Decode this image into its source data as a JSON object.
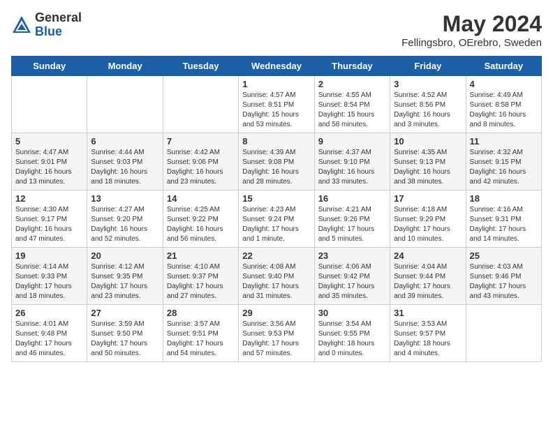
{
  "header": {
    "logo_general": "General",
    "logo_blue": "Blue",
    "month": "May 2024",
    "location": "Fellingsbro, OErebro, Sweden"
  },
  "days_of_week": [
    "Sunday",
    "Monday",
    "Tuesday",
    "Wednesday",
    "Thursday",
    "Friday",
    "Saturday"
  ],
  "weeks": [
    [
      {
        "day": "",
        "info": ""
      },
      {
        "day": "",
        "info": ""
      },
      {
        "day": "",
        "info": ""
      },
      {
        "day": "1",
        "info": "Sunrise: 4:57 AM\nSunset: 8:51 PM\nDaylight: 15 hours\nand 53 minutes."
      },
      {
        "day": "2",
        "info": "Sunrise: 4:55 AM\nSunset: 8:54 PM\nDaylight: 15 hours\nand 58 minutes."
      },
      {
        "day": "3",
        "info": "Sunrise: 4:52 AM\nSunset: 8:56 PM\nDaylight: 16 hours\nand 3 minutes."
      },
      {
        "day": "4",
        "info": "Sunrise: 4:49 AM\nSunset: 8:58 PM\nDaylight: 16 hours\nand 8 minutes."
      }
    ],
    [
      {
        "day": "5",
        "info": "Sunrise: 4:47 AM\nSunset: 9:01 PM\nDaylight: 16 hours\nand 13 minutes."
      },
      {
        "day": "6",
        "info": "Sunrise: 4:44 AM\nSunset: 9:03 PM\nDaylight: 16 hours\nand 18 minutes."
      },
      {
        "day": "7",
        "info": "Sunrise: 4:42 AM\nSunset: 9:06 PM\nDaylight: 16 hours\nand 23 minutes."
      },
      {
        "day": "8",
        "info": "Sunrise: 4:39 AM\nSunset: 9:08 PM\nDaylight: 16 hours\nand 28 minutes."
      },
      {
        "day": "9",
        "info": "Sunrise: 4:37 AM\nSunset: 9:10 PM\nDaylight: 16 hours\nand 33 minutes."
      },
      {
        "day": "10",
        "info": "Sunrise: 4:35 AM\nSunset: 9:13 PM\nDaylight: 16 hours\nand 38 minutes."
      },
      {
        "day": "11",
        "info": "Sunrise: 4:32 AM\nSunset: 9:15 PM\nDaylight: 16 hours\nand 42 minutes."
      }
    ],
    [
      {
        "day": "12",
        "info": "Sunrise: 4:30 AM\nSunset: 9:17 PM\nDaylight: 16 hours\nand 47 minutes."
      },
      {
        "day": "13",
        "info": "Sunrise: 4:27 AM\nSunset: 9:20 PM\nDaylight: 16 hours\nand 52 minutes."
      },
      {
        "day": "14",
        "info": "Sunrise: 4:25 AM\nSunset: 9:22 PM\nDaylight: 16 hours\nand 56 minutes."
      },
      {
        "day": "15",
        "info": "Sunrise: 4:23 AM\nSunset: 9:24 PM\nDaylight: 17 hours\nand 1 minute."
      },
      {
        "day": "16",
        "info": "Sunrise: 4:21 AM\nSunset: 9:26 PM\nDaylight: 17 hours\nand 5 minutes."
      },
      {
        "day": "17",
        "info": "Sunrise: 4:18 AM\nSunset: 9:29 PM\nDaylight: 17 hours\nand 10 minutes."
      },
      {
        "day": "18",
        "info": "Sunrise: 4:16 AM\nSunset: 9:31 PM\nDaylight: 17 hours\nand 14 minutes."
      }
    ],
    [
      {
        "day": "19",
        "info": "Sunrise: 4:14 AM\nSunset: 9:33 PM\nDaylight: 17 hours\nand 18 minutes."
      },
      {
        "day": "20",
        "info": "Sunrise: 4:12 AM\nSunset: 9:35 PM\nDaylight: 17 hours\nand 23 minutes."
      },
      {
        "day": "21",
        "info": "Sunrise: 4:10 AM\nSunset: 9:37 PM\nDaylight: 17 hours\nand 27 minutes."
      },
      {
        "day": "22",
        "info": "Sunrise: 4:08 AM\nSunset: 9:40 PM\nDaylight: 17 hours\nand 31 minutes."
      },
      {
        "day": "23",
        "info": "Sunrise: 4:06 AM\nSunset: 9:42 PM\nDaylight: 17 hours\nand 35 minutes."
      },
      {
        "day": "24",
        "info": "Sunrise: 4:04 AM\nSunset: 9:44 PM\nDaylight: 17 hours\nand 39 minutes."
      },
      {
        "day": "25",
        "info": "Sunrise: 4:03 AM\nSunset: 9:46 PM\nDaylight: 17 hours\nand 43 minutes."
      }
    ],
    [
      {
        "day": "26",
        "info": "Sunrise: 4:01 AM\nSunset: 9:48 PM\nDaylight: 17 hours\nand 46 minutes."
      },
      {
        "day": "27",
        "info": "Sunrise: 3:59 AM\nSunset: 9:50 PM\nDaylight: 17 hours\nand 50 minutes."
      },
      {
        "day": "28",
        "info": "Sunrise: 3:57 AM\nSunset: 9:51 PM\nDaylight: 17 hours\nand 54 minutes."
      },
      {
        "day": "29",
        "info": "Sunrise: 3:56 AM\nSunset: 9:53 PM\nDaylight: 17 hours\nand 57 minutes."
      },
      {
        "day": "30",
        "info": "Sunrise: 3:54 AM\nSunset: 9:55 PM\nDaylight: 18 hours\nand 0 minutes."
      },
      {
        "day": "31",
        "info": "Sunrise: 3:53 AM\nSunset: 9:57 PM\nDaylight: 18 hours\nand 4 minutes."
      },
      {
        "day": "",
        "info": ""
      }
    ]
  ]
}
